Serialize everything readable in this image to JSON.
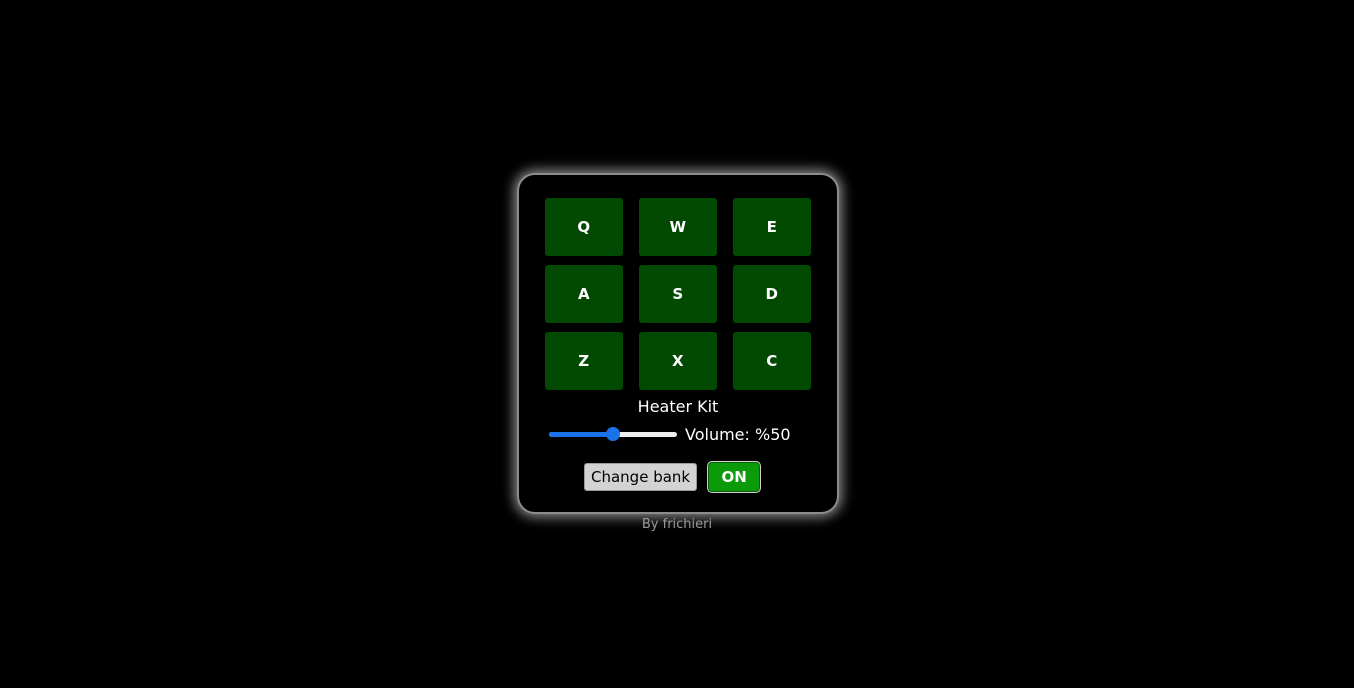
{
  "pads": [
    "Q",
    "W",
    "E",
    "A",
    "S",
    "D",
    "Z",
    "X",
    "C"
  ],
  "display": {
    "text": "Heater Kit"
  },
  "volume": {
    "label": "Volume: %50",
    "value": 0.5
  },
  "controls": {
    "bank_label": "Change bank",
    "power_label": "ON"
  },
  "footer": {
    "credit": "By frichieri"
  },
  "colors": {
    "background": "#000000",
    "pad": "#024a02",
    "power_on": "#0a9a0a",
    "slider_accent": "#1a73e8"
  }
}
